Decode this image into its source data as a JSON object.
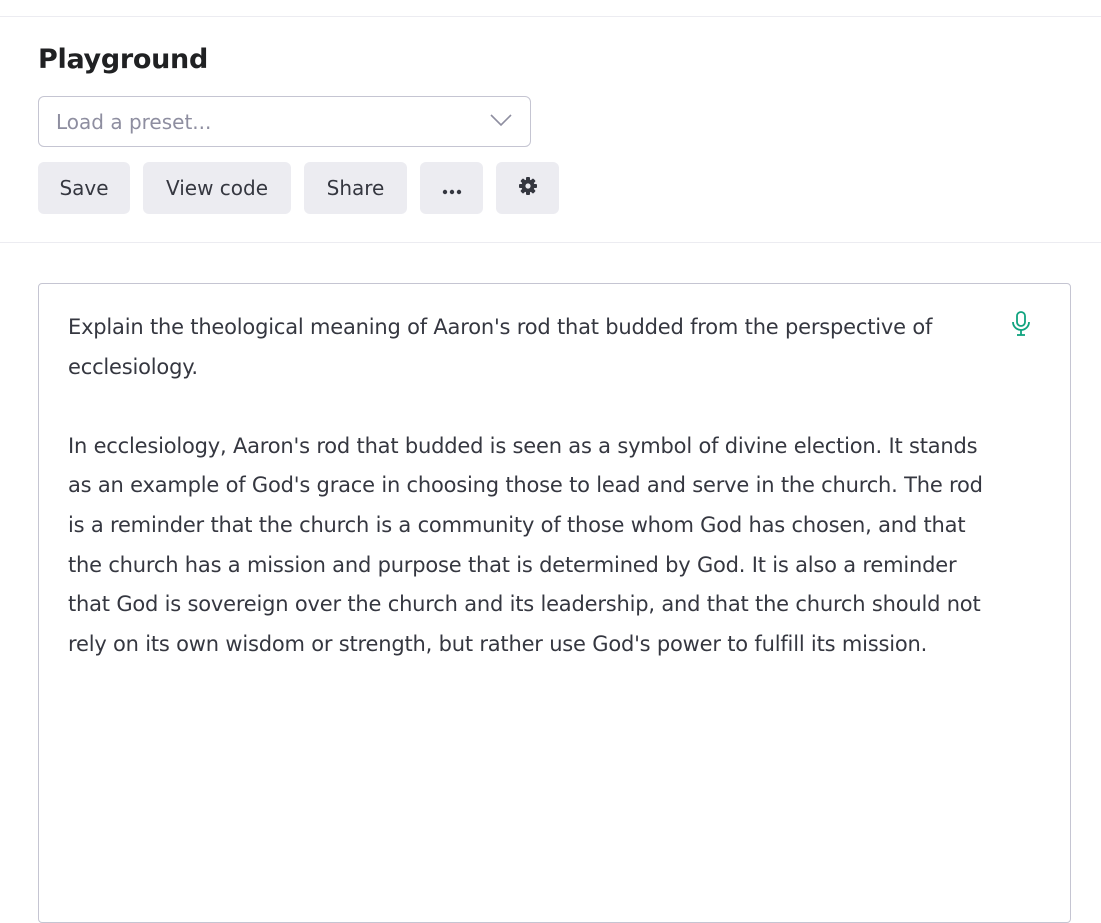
{
  "header": {
    "title": "Playground",
    "preset_placeholder": "Load a preset..."
  },
  "toolbar": {
    "save_label": "Save",
    "view_code_label": "View code",
    "share_label": "Share",
    "more_icon": "ellipsis-icon",
    "settings_icon": "gear-icon"
  },
  "editor": {
    "prompt": "Explain the theological meaning of Aaron's rod that budded from the perspective of ecclesiology.",
    "response": "In ecclesiology, Aaron's rod that budded is seen as a symbol of divine election. It stands as an example of God's grace in choosing those to lead and serve in the church. The rod is a reminder that the church is a community of those whom God has chosen, and that the church has a mission and purpose that is determined by God. It is also a reminder that God is sovereign over the church and its leadership, and that the church should not rely on its own wisdom or strength, but rather use God's power to fulfill its mission.",
    "mic_icon": "microphone-icon"
  },
  "colors": {
    "accent": "#10a37f",
    "button_bg": "#ececf1",
    "border": "#c5c5d2"
  }
}
